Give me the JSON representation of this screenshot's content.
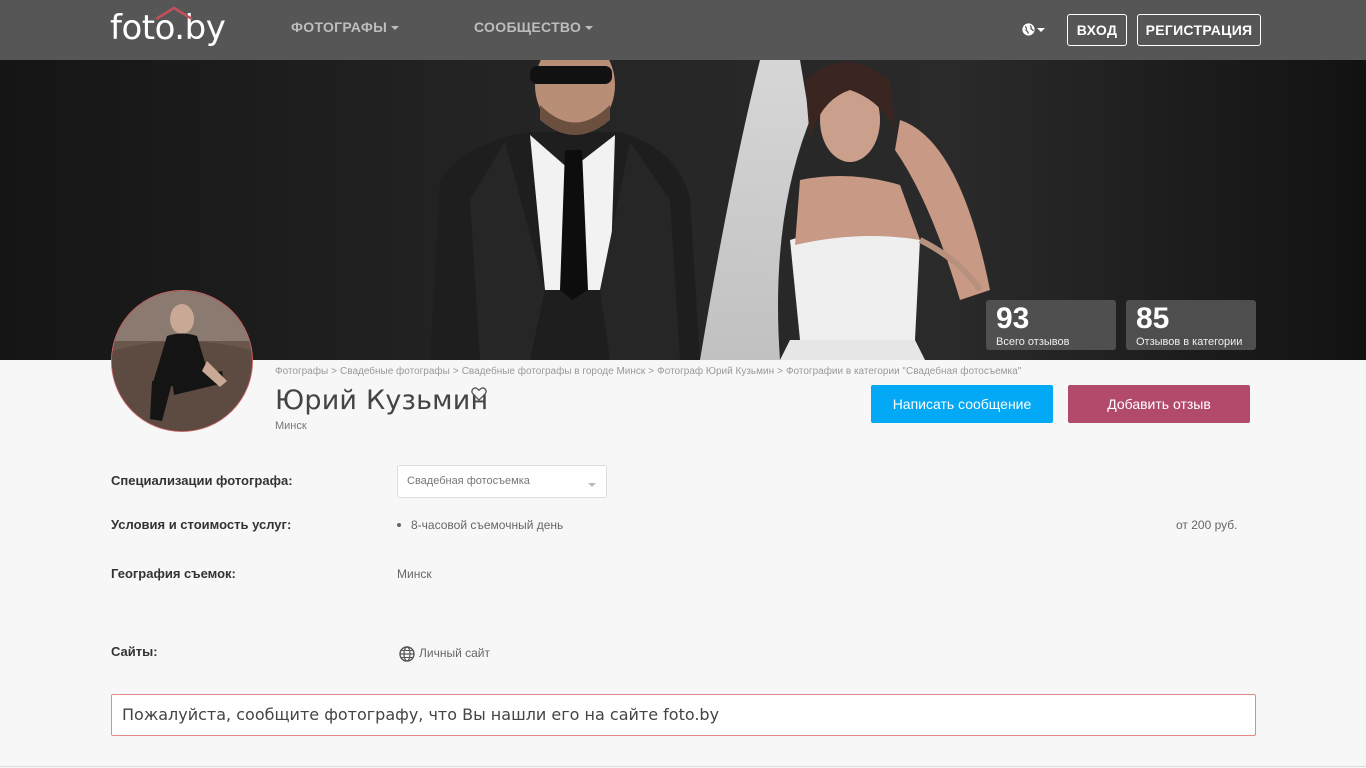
{
  "header": {
    "logo": "foto.by",
    "nav": [
      {
        "label": "ФОТОГРАФЫ"
      },
      {
        "label": "СООБЩЕСТВО"
      }
    ],
    "login_label": "ВХОД",
    "register_label": "РЕГИСТРАЦИЯ"
  },
  "stats": [
    {
      "value": "93",
      "label": "Всего отзывов"
    },
    {
      "value": "85",
      "label": "Отзывов в категории"
    }
  ],
  "breadcrumb": [
    "Фотографы",
    "Свадебные фотографы",
    "Свадебные фотографы в городе Минск",
    "Фотограф Юрий Кузьмин",
    "Фотографии в категории \"Свадебная фотосъемка\""
  ],
  "profile": {
    "name": "Юрий Кузьмин",
    "city": "Минск",
    "message_button": "Написать сообщение",
    "review_button": "Добавить отзыв"
  },
  "details": {
    "specializations_label": "Специализации фотографа:",
    "specialization_selected": "Свадебная фотосъемка",
    "services_label": "Условия и стоимость услуг:",
    "service_name": "8-часовой съемочный день",
    "service_price": "от 200 руб.",
    "geography_label": "География съемок:",
    "geography_value": "Минск",
    "sites_label": "Сайты:",
    "site_link": "Личный сайт"
  },
  "notice": "Пожалуйста, сообщите фотографу, что Вы нашли его на сайте foto.by",
  "colors": {
    "navbar": "#565656",
    "message_button": "#03a9f4",
    "review_button": "#b24a6c",
    "notice_border": "#e38b8b"
  }
}
